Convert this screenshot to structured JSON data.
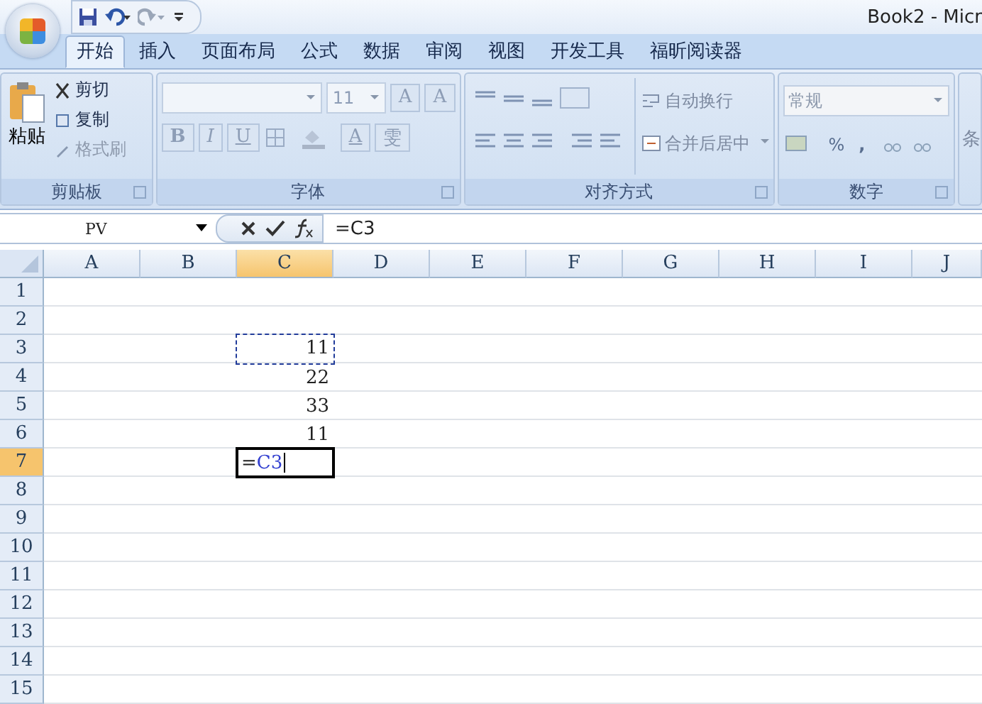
{
  "title_bar": {
    "title": "Book2 - Micr"
  },
  "tabs": [
    {
      "label": "开始",
      "selected": true
    },
    {
      "label": "插入",
      "selected": false
    },
    {
      "label": "页面布局",
      "selected": false
    },
    {
      "label": "公式",
      "selected": false
    },
    {
      "label": "数据",
      "selected": false
    },
    {
      "label": "审阅",
      "selected": false
    },
    {
      "label": "视图",
      "selected": false
    },
    {
      "label": "开发工具",
      "selected": false
    },
    {
      "label": "福昕阅读器",
      "selected": false
    }
  ],
  "clipboard": {
    "paste": "粘贴",
    "items": [
      {
        "label": "剪切",
        "disabled": false
      },
      {
        "label": "复制",
        "disabled": false
      },
      {
        "label": "格式刷",
        "disabled": true
      }
    ],
    "group_label": "剪贴板"
  },
  "font": {
    "disabled": true,
    "size": "11",
    "grow": "A",
    "shrink": "A",
    "styles": [
      "B",
      "I",
      "U"
    ],
    "font_color": "A",
    "phonetic": "雯",
    "group_label": "字体"
  },
  "alignment": {
    "wrap_text": "自动换行",
    "merge_center": "合并后居中",
    "group_label": "对齐方式"
  },
  "number": {
    "format": "常规",
    "percent": "%",
    "comma": ",",
    "group_label": "数字"
  },
  "next_group": {
    "label": "条"
  },
  "formula_bar": {
    "name_box": "PV",
    "formula": "=C3"
  },
  "sheet": {
    "columns": [
      {
        "label": "A",
        "selected": false
      },
      {
        "label": "B",
        "selected": false
      },
      {
        "label": "C",
        "selected": true
      },
      {
        "label": "D",
        "selected": false
      },
      {
        "label": "E",
        "selected": false
      },
      {
        "label": "F",
        "selected": false
      },
      {
        "label": "G",
        "selected": false
      },
      {
        "label": "H",
        "selected": false
      },
      {
        "label": "I",
        "selected": false
      },
      {
        "label": "J",
        "selected": false
      }
    ],
    "rows": [
      {
        "label": "1",
        "selected": false
      },
      {
        "label": "2",
        "selected": false
      },
      {
        "label": "3",
        "selected": false,
        "cells": {
          "C": {
            "kind": "reference",
            "value": "11"
          }
        }
      },
      {
        "label": "4",
        "selected": false,
        "cells": {
          "C": {
            "kind": "number",
            "value": "22"
          }
        }
      },
      {
        "label": "5",
        "selected": false,
        "cells": {
          "C": {
            "kind": "number",
            "value": "33"
          }
        }
      },
      {
        "label": "6",
        "selected": false,
        "cells": {
          "C": {
            "kind": "number",
            "value": "11"
          }
        }
      },
      {
        "label": "7",
        "selected": true,
        "cells": {
          "C": {
            "kind": "editing",
            "prefix": "=",
            "reference": "C3"
          }
        }
      },
      {
        "label": "8",
        "selected": false
      },
      {
        "label": "9",
        "selected": false
      },
      {
        "label": "10",
        "selected": false
      },
      {
        "label": "11",
        "selected": false
      },
      {
        "label": "12",
        "selected": false
      },
      {
        "label": "13",
        "selected": false
      },
      {
        "label": "14",
        "selected": false
      },
      {
        "label": "15",
        "selected": false
      }
    ]
  }
}
